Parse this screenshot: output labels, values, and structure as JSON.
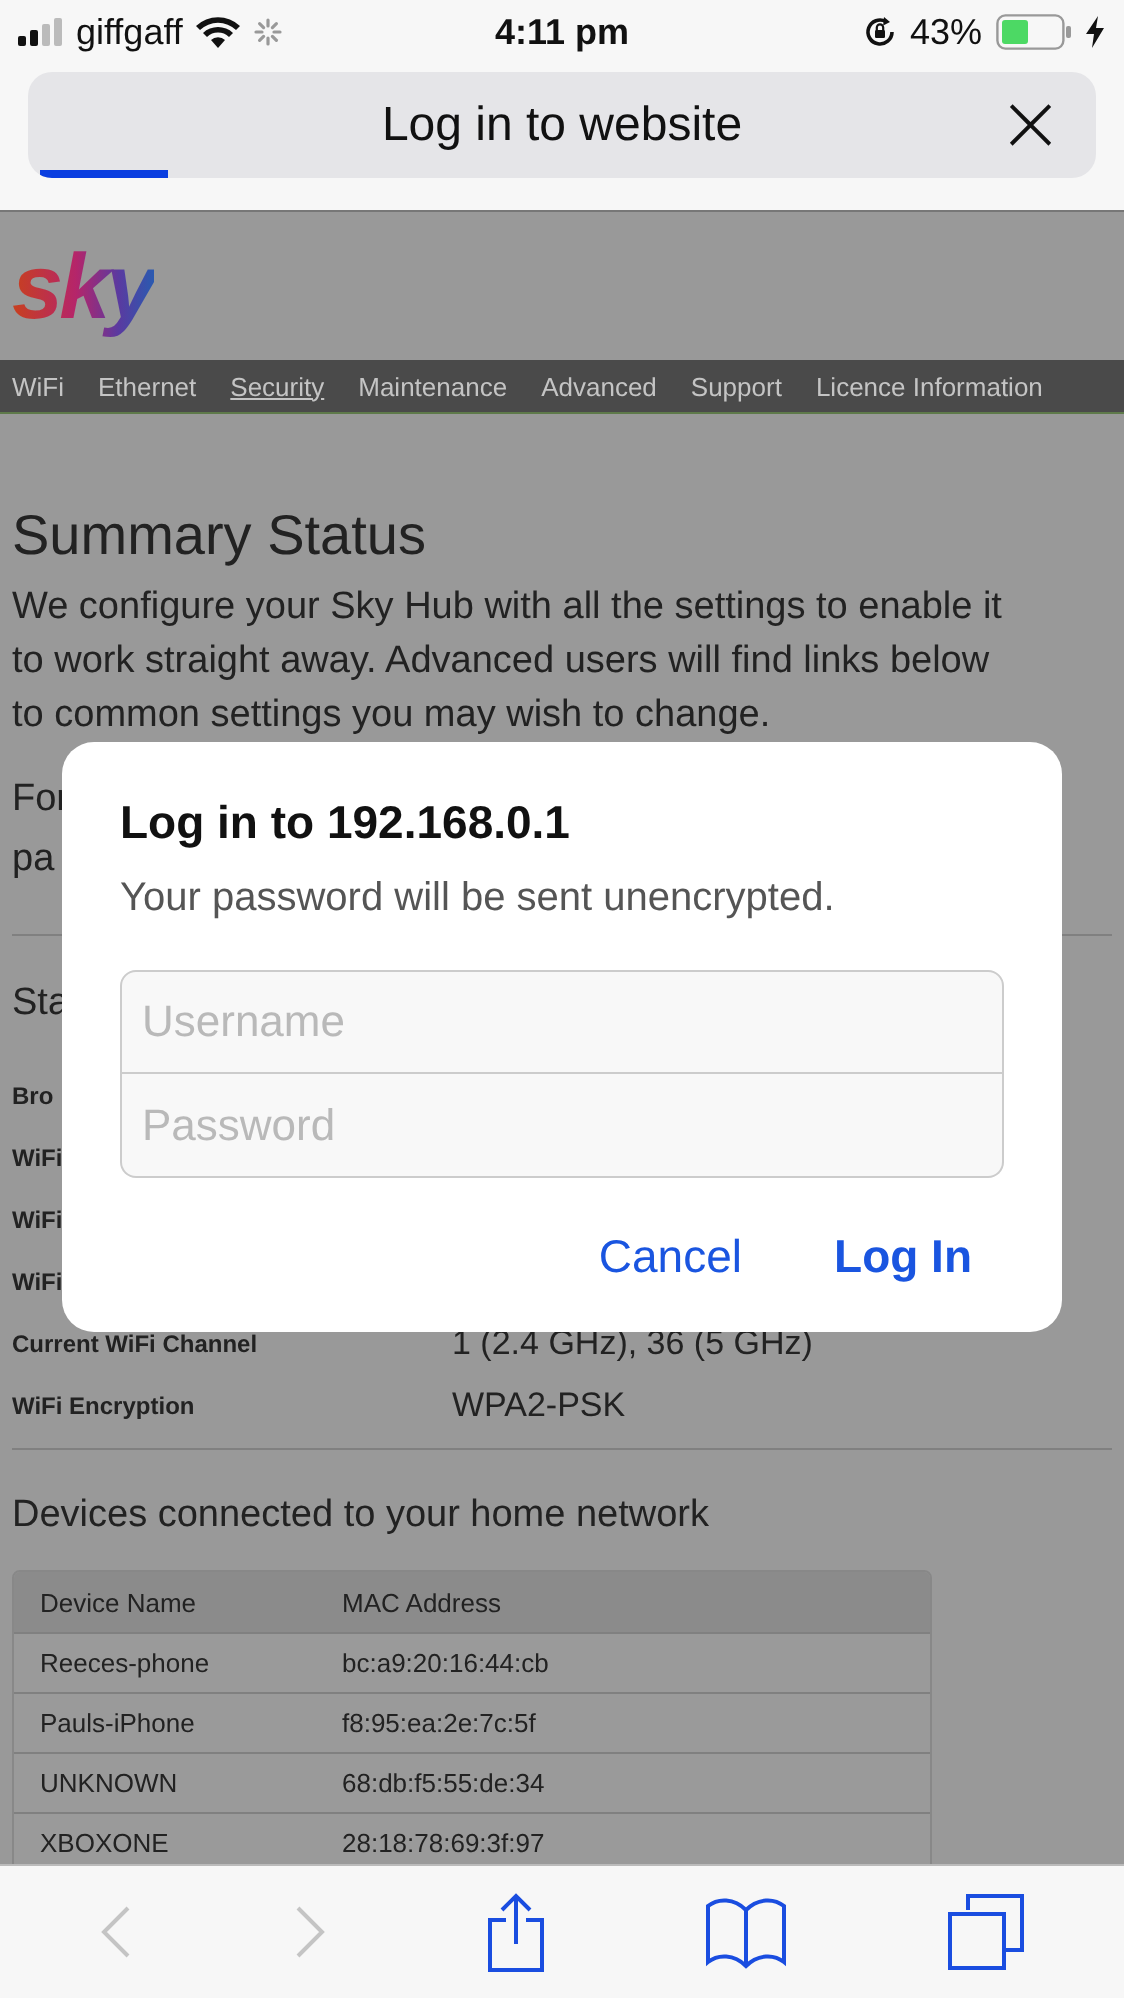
{
  "status_bar": {
    "carrier": "giffgaff",
    "time": "4:11 pm",
    "battery": "43%"
  },
  "address_bar": {
    "title": "Log in to website",
    "close": "×",
    "loading": {
      "level": 0.12
    }
  },
  "page": {
    "logo": "sky",
    "nav": [
      {
        "label": "WiFi",
        "selected": false
      },
      {
        "label": "Ethernet",
        "selected": false
      },
      {
        "label": "Security",
        "selected": true
      },
      {
        "label": "Maintenance",
        "selected": false
      },
      {
        "label": "Advanced",
        "selected": false
      },
      {
        "label": "Support",
        "selected": false
      },
      {
        "label": "Licence Information",
        "selected": false
      }
    ],
    "heading": "Summary Status",
    "intro": "We configure your Sky Hub with all the settings to enable it to work straight away. Advanced users will find links below to common settings you may wish to change.",
    "partial_paragraph": "For pa",
    "status_heading": "Sta",
    "status_rows": [
      {
        "label": "Bro"
      },
      {
        "label": "WiFi"
      },
      {
        "label": "WiFi"
      },
      {
        "label": "WiFi"
      },
      {
        "label": "Current WiFi Channel",
        "value": "1 (2.4 GHz), 36 (5 GHz)"
      },
      {
        "label": "WiFi Encryption",
        "value": "WPA2-PSK"
      }
    ],
    "devices_heading": "Devices connected to your home network",
    "table": {
      "columns": [
        "Device Name",
        "MAC Address"
      ],
      "rows": [
        [
          "Reeces-phone",
          "bc:a9:20:16:44:cb"
        ],
        [
          "Pauls-iPhone",
          "f8:95:ea:2e:7c:5f"
        ],
        [
          "UNKNOWN",
          "68:db:f5:55:de:34"
        ],
        [
          "XBOXONE",
          "28:18:78:69:3f:97"
        ]
      ]
    }
  },
  "dialog": {
    "title": "Log in to 192.168.0.1",
    "message": "Your password will be sent unencrypted.",
    "username_placeholder": "Username",
    "password_placeholder": "Password",
    "buttons": [
      {
        "label": "Cancel",
        "kind": "cancel"
      },
      {
        "label": "Log In",
        "kind": "default"
      }
    ]
  }
}
